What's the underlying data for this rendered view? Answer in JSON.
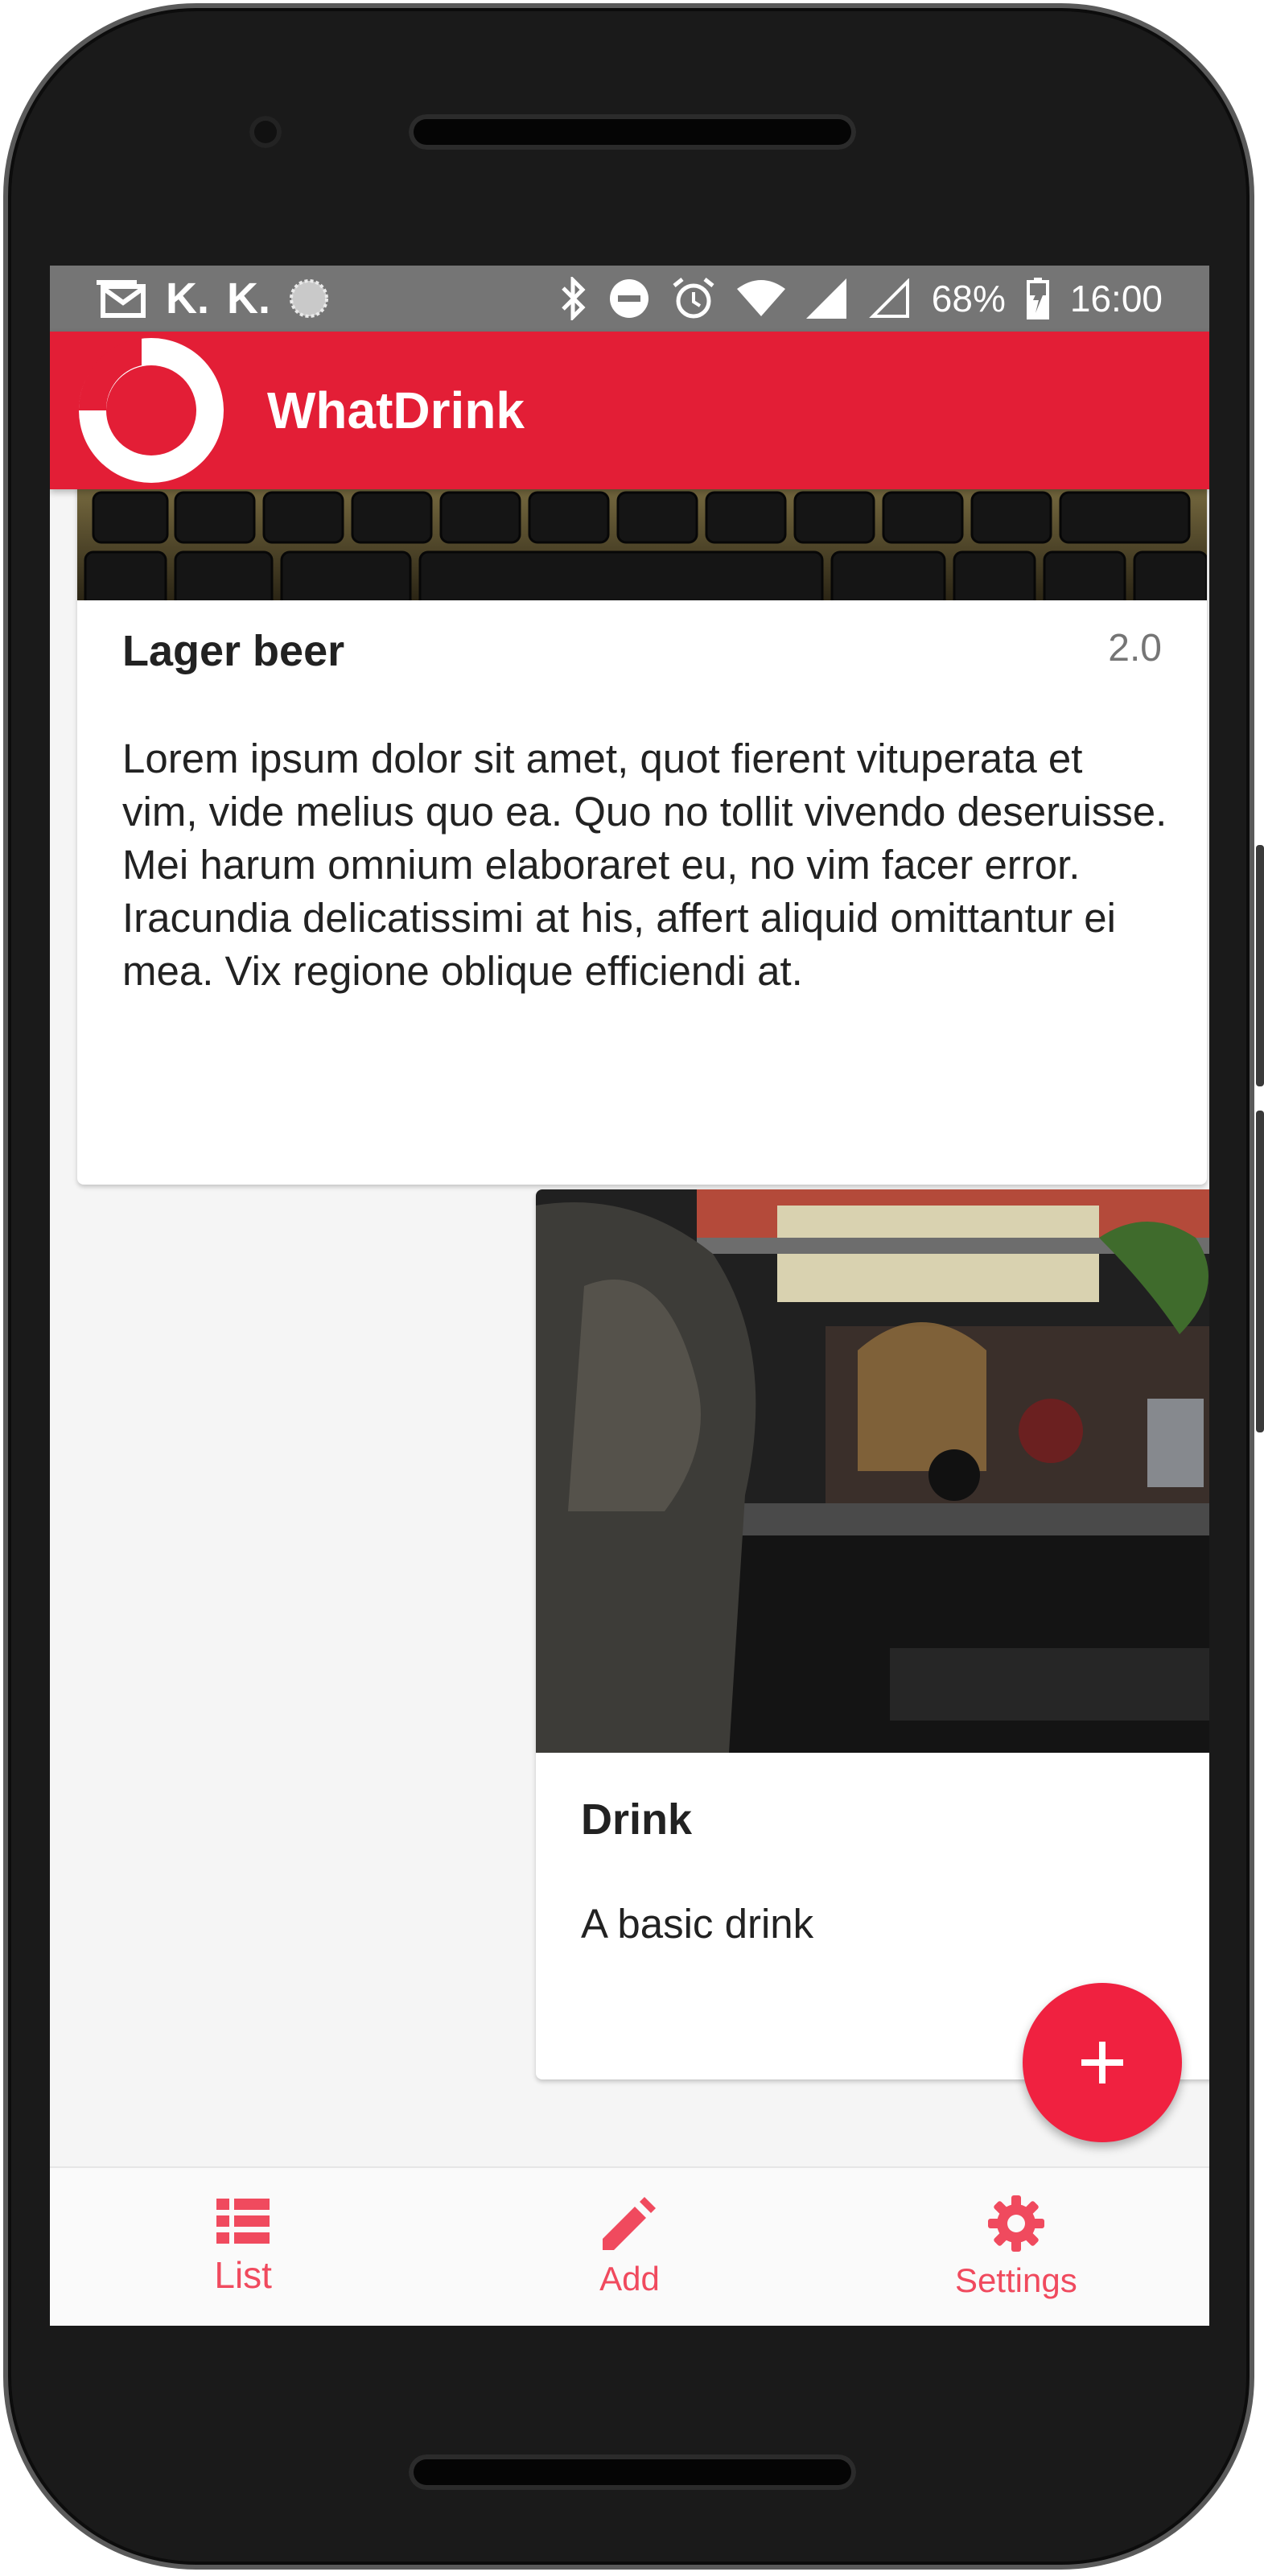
{
  "statusbar": {
    "left_icons": [
      "gmail-icon",
      "k-icon",
      "k-icon",
      "circle-icon"
    ],
    "k_glyph": "K.",
    "battery": "68%",
    "time": "16:00",
    "right_icons": [
      "bluetooth-icon",
      "do-not-disturb-icon",
      "alarm-icon",
      "wifi-icon",
      "signal-icon",
      "signal-empty-icon",
      "battery-icon"
    ]
  },
  "appbar": {
    "title": "WhatDrink",
    "color": "#e31e36"
  },
  "cards": [
    {
      "title": "Lager beer",
      "score": "2.0",
      "description": "Lorem ipsum dolor sit amet, quot fierent vituperata et vim, vide melius quo ea. Quo no tollit vivendo deseruisse. Mei harum omnium elaboraret eu, no vim facer error. Iracundia delicatissimi at his, affert aliquid omittantur ei mea. Vix regione oblique efficiendi at."
    },
    {
      "title": "Drink",
      "description": "A basic drink"
    }
  ],
  "fab": {
    "icon": "plus-icon",
    "glyph": "+"
  },
  "bottom_nav": {
    "items": [
      {
        "label": "List",
        "icon": "list-icon",
        "active": true
      },
      {
        "label": "Add",
        "icon": "pencil-icon",
        "active": false
      },
      {
        "label": "Settings",
        "icon": "gear-icon",
        "active": false
      }
    ],
    "color": "#f04a5e"
  }
}
